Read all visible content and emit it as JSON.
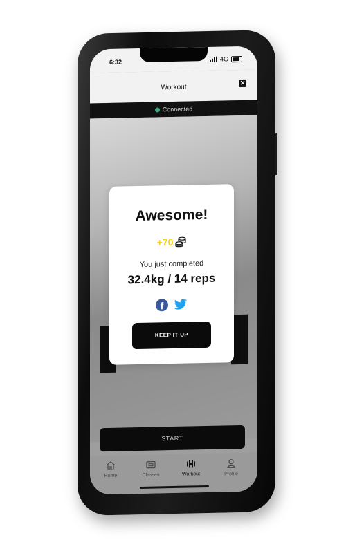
{
  "status": {
    "time": "6:32",
    "network": "4G"
  },
  "header": {
    "title": "Workout",
    "close_icon": "close-icon"
  },
  "connection": {
    "status": "Connected",
    "status_color": "#3fa77c"
  },
  "main": {
    "start_label": "START"
  },
  "tabs": [
    {
      "label": "Home",
      "icon": "home-icon",
      "active": false
    },
    {
      "label": "Classes",
      "icon": "classes-icon",
      "active": false
    },
    {
      "label": "Workout",
      "icon": "dumbbell-icon",
      "active": true
    },
    {
      "label": "Profile",
      "icon": "profile-icon",
      "active": false
    }
  ],
  "modal": {
    "title": "Awesome!",
    "points": "+70",
    "points_icon": "coins-icon",
    "subtitle": "You just completed",
    "stat": "32.4kg / 14 reps",
    "share": {
      "facebook_icon": "facebook-icon",
      "twitter_icon": "twitter-icon"
    },
    "cta_label": "KEEP IT UP",
    "accent_color": "#f2d21b"
  }
}
